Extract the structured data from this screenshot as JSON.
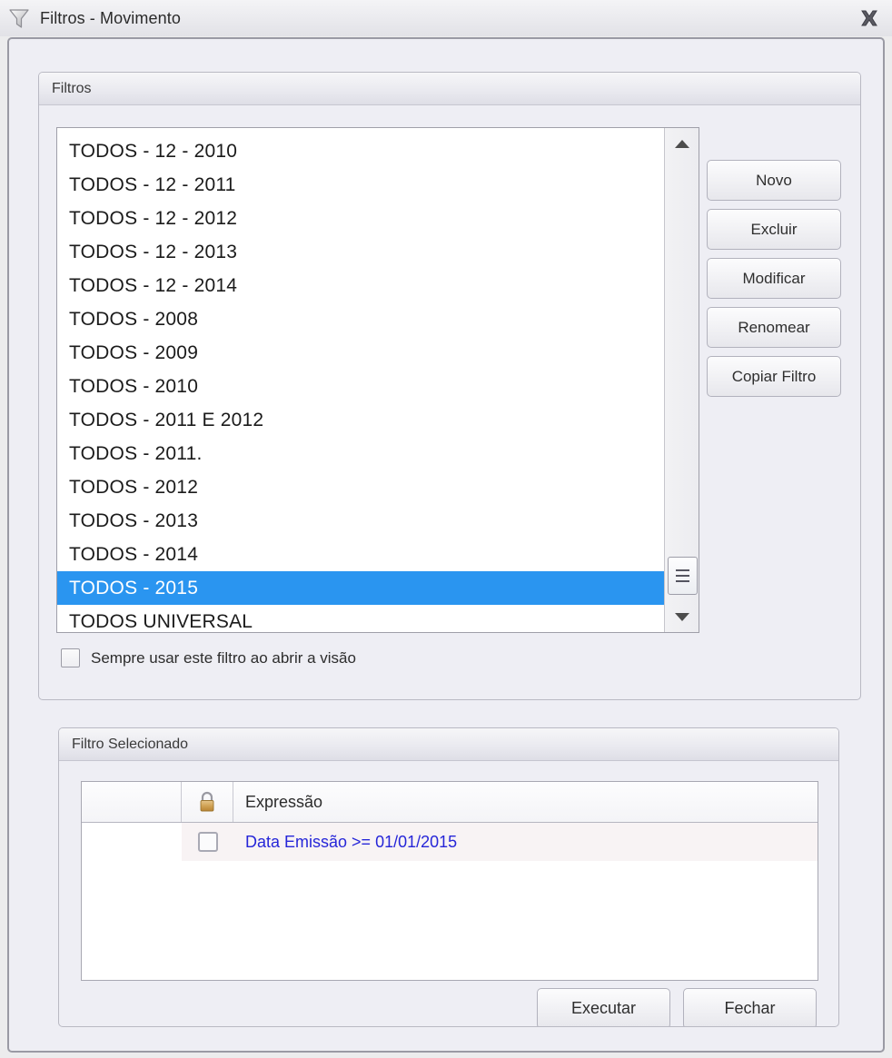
{
  "window": {
    "title": "Filtros - Movimento",
    "icon": "funnel-icon",
    "close_icon": "close-icon"
  },
  "filters_group": {
    "title": "Filtros",
    "items": [
      "TODOS - 12 - 2010",
      "TODOS - 12 - 2011",
      "TODOS - 12 - 2012",
      "TODOS - 12 - 2013",
      "TODOS - 12 - 2014",
      "TODOS - 2008",
      "TODOS - 2009",
      "TODOS - 2010",
      "TODOS - 2011 E 2012",
      "TODOS - 2011.",
      "TODOS - 2012",
      "TODOS - 2013",
      "TODOS - 2014",
      "TODOS - 2015",
      "TODOS UNIVERSAL"
    ],
    "selected_item": "TODOS - 2015",
    "selected_index": 13,
    "buttons": [
      "Novo",
      "Excluir",
      "Modificar",
      "Renomear",
      "Copiar Filtro"
    ],
    "always_use_checkbox": {
      "label": "Sempre usar este filtro ao abrir a visão",
      "checked": false
    },
    "scrollbar": {
      "up_icon": "scroll-up-arrow-icon",
      "down_icon": "scroll-down-arrow-icon",
      "thumb_icon": "scrollbar-thumb-grip-icon"
    }
  },
  "selected_filter_group": {
    "title": "Filtro Selecionado",
    "table": {
      "headers": [
        "",
        "lock-icon",
        "Expressão"
      ],
      "expression_header": "Expressão",
      "lock_icon": "lock-icon",
      "rows": [
        {
          "checked": false,
          "expression": "Data Emissão >= 01/01/2015"
        }
      ]
    },
    "buttons": {
      "execute": "Executar",
      "close": "Fechar"
    }
  },
  "colors": {
    "selection_blue": "#2a95f0",
    "expression_text": "#2626d8",
    "lock_gold": "#c9983f",
    "panel_bg": "#eeeef4",
    "window_bg": "#ececed"
  }
}
